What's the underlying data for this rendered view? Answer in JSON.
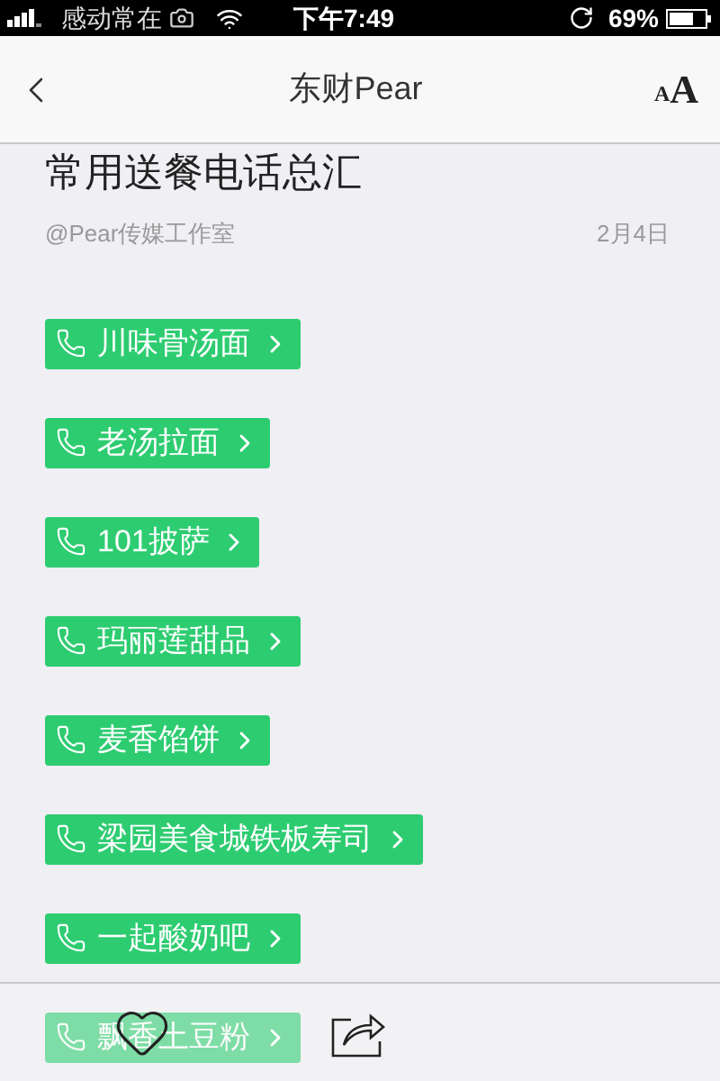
{
  "status_bar": {
    "carrier": "感动常在",
    "time": "下午7:49",
    "battery": "69%"
  },
  "nav_bar": {
    "title": "东财Pear",
    "font_small": "A",
    "font_large": "A"
  },
  "article": {
    "title": "常用送餐电话总汇",
    "author": "@Pear传媒工作室",
    "date": "2月4日"
  },
  "contacts": [
    {
      "name": "川味骨汤面"
    },
    {
      "name": "老汤拉面"
    },
    {
      "name": "101披萨"
    },
    {
      "name": "玛丽莲甜品"
    },
    {
      "name": "麦香馅饼"
    },
    {
      "name": "梁园美食城铁板寿司"
    },
    {
      "name": "一起酸奶吧"
    },
    {
      "name": "飘香土豆粉"
    }
  ]
}
